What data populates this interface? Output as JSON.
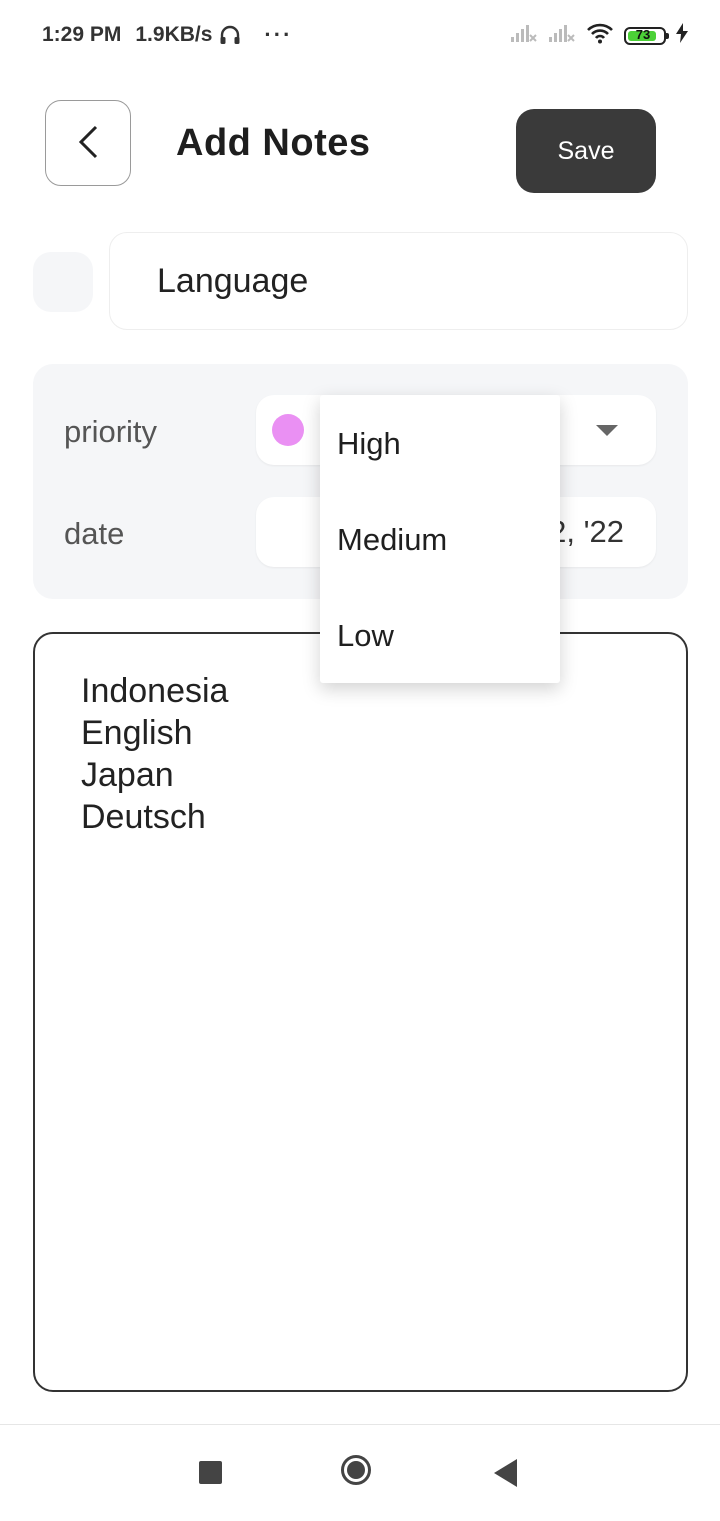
{
  "status_bar": {
    "time": "1:29 PM",
    "network_speed": "1.9KB/s",
    "headphones_icon": "headphones-icon",
    "more_indicator": "···",
    "battery_level": "73"
  },
  "header": {
    "back_icon": "chevron-left-icon",
    "title": "Add Notes",
    "save_label": "Save"
  },
  "note": {
    "title": "Language",
    "body": "Indonesia\nEnglish\nJapan\nDeutsch"
  },
  "meta": {
    "priority_label": "priority",
    "date_label": "date",
    "priority_dot_color": "#ea90f3",
    "date_value_partial": "2, '22"
  },
  "priority_menu": {
    "options": [
      "High",
      "Medium",
      "Low"
    ]
  },
  "nav_bar": {
    "recents_icon": "square-icon",
    "home_icon": "circle-icon",
    "back_icon": "triangle-back-icon"
  }
}
